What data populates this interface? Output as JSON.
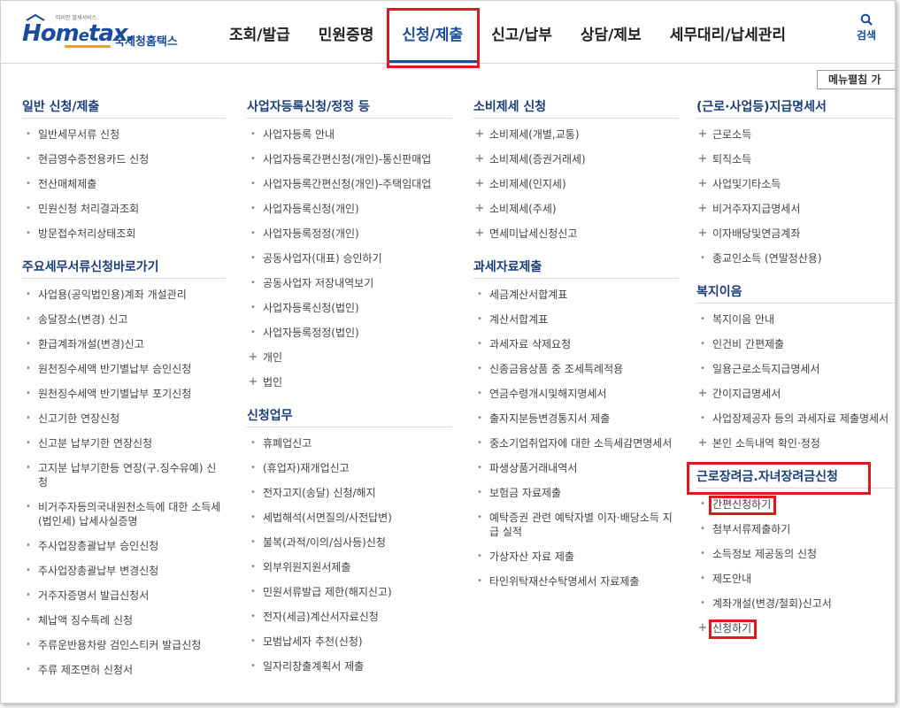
{
  "logo": {
    "tiny": "티이안 발세서비스",
    "main_left": "Hom",
    "main_e": "e",
    "main_right": "tax.",
    "sub": "국세청홈택스"
  },
  "nav": {
    "items": [
      "조회/발급",
      "민원증명",
      "신청/제출",
      "신고/납부",
      "상담/제보",
      "세무대리/납세관리"
    ],
    "active_index": 2
  },
  "search": {
    "label": "검색",
    "icon": "search-icon"
  },
  "menu_toggle": "메뉴펼침 가",
  "columns": [
    {
      "sections": [
        {
          "title": "일반 신청/제출",
          "items": [
            {
              "m": "•",
              "t": "일반세무서류 신청"
            },
            {
              "m": "•",
              "t": "현금영수증전용카드 신청"
            },
            {
              "m": "•",
              "t": "전산매체제출"
            },
            {
              "m": "•",
              "t": "민원신청 처리결과조회"
            },
            {
              "m": "•",
              "t": "방문접수처리상태조회"
            }
          ]
        },
        {
          "title": "주요세무서류신청바로가기",
          "items": [
            {
              "m": "•",
              "t": "사업용(공익법인용)계좌 개설관리"
            },
            {
              "m": "•",
              "t": "송달장소(변경) 신고"
            },
            {
              "m": "•",
              "t": "환급계좌개설(변경)신고"
            },
            {
              "m": "•",
              "t": "원천징수세액 반기별납부 승인신청"
            },
            {
              "m": "•",
              "t": "원천징수세액 반기별납부 포기신청"
            },
            {
              "m": "•",
              "t": "신고기한 연장신청"
            },
            {
              "m": "•",
              "t": "신고분 납부기한 연장신청"
            },
            {
              "m": "•",
              "t": "고지분 납부기한등 연장(구.징수유예) 신청"
            },
            {
              "m": "•",
              "t": "비거주자등의국내원천소득에 대한 소득세(법인세) 납세사실증명"
            },
            {
              "m": "•",
              "t": "주사업장총괄납부 승인신청"
            },
            {
              "m": "•",
              "t": "주사업장총괄납부 변경신청"
            },
            {
              "m": "•",
              "t": "거주자증명서 발급신청서"
            },
            {
              "m": "•",
              "t": "체납액 징수특례 신청"
            },
            {
              "m": "•",
              "t": "주류운반용차량 검인스티커 발급신청"
            },
            {
              "m": "•",
              "t": "주류 제조면허 신청서"
            }
          ]
        }
      ]
    },
    {
      "sections": [
        {
          "title": "사업자등록신청/정정 등",
          "items": [
            {
              "m": "•",
              "t": "사업자등록 안내"
            },
            {
              "m": "•",
              "t": "사업자등록간편신청(개인)-통신판매업"
            },
            {
              "m": "•",
              "t": "사업자등록간편신청(개인)-주택임대업"
            },
            {
              "m": "•",
              "t": "사업자등록신청(개인)"
            },
            {
              "m": "•",
              "t": "사업자등록정정(개인)"
            },
            {
              "m": "•",
              "t": "공동사업자(대표) 승인하기"
            },
            {
              "m": "•",
              "t": "공동사업자 저장내역보기"
            },
            {
              "m": "•",
              "t": "사업자등록신청(법인)"
            },
            {
              "m": "•",
              "t": "사업자등록정정(법인)"
            },
            {
              "m": "+",
              "t": "개인"
            },
            {
              "m": "+",
              "t": "법인"
            }
          ]
        },
        {
          "title": "신청업무",
          "items": [
            {
              "m": "•",
              "t": "휴폐업신고"
            },
            {
              "m": "•",
              "t": "(휴업자)재개업신고"
            },
            {
              "m": "•",
              "t": "전자고지(송달) 신청/해지"
            },
            {
              "m": "•",
              "t": "세법해석(서면질의/사전답변)"
            },
            {
              "m": "•",
              "t": "불복(과적/이의/심사등)신청"
            },
            {
              "m": "•",
              "t": "외부위원지원서제출"
            },
            {
              "m": "•",
              "t": "민원서류발급 제한(해지신고)"
            },
            {
              "m": "•",
              "t": "전자(세금)계산서자료신청"
            },
            {
              "m": "•",
              "t": "모범납세자 추천(신청)"
            },
            {
              "m": "•",
              "t": "일자리창출계획서 제출"
            }
          ]
        }
      ]
    },
    {
      "sections": [
        {
          "title": "소비제세 신청",
          "items": [
            {
              "m": "+",
              "t": "소비제세(개별,교통)"
            },
            {
              "m": "+",
              "t": "소비제세(증권거래세)"
            },
            {
              "m": "+",
              "t": "소비제세(인지세)"
            },
            {
              "m": "+",
              "t": "소비제세(주세)"
            },
            {
              "m": "+",
              "t": "면세미납세신청신고"
            }
          ]
        },
        {
          "title": "과세자료제출",
          "items": [
            {
              "m": "•",
              "t": "세금계산서합계표"
            },
            {
              "m": "•",
              "t": "계산서합계표"
            },
            {
              "m": "•",
              "t": "과세자료 삭제요청"
            },
            {
              "m": "•",
              "t": "신종금융상품 중 조세특례적용"
            },
            {
              "m": "•",
              "t": "연금수령개시및해지명세서"
            },
            {
              "m": "•",
              "t": "출자지분등변경통지서 제출"
            },
            {
              "m": "•",
              "t": "중소기업취업자에 대한 소득세감면명세서"
            },
            {
              "m": "•",
              "t": "파생상품거래내역서"
            },
            {
              "m": "•",
              "t": "보험금 자료제출"
            },
            {
              "m": "•",
              "t": "예탁증권 관련 예탁자별 이자·배당소득 지급 실적"
            },
            {
              "m": "•",
              "t": "가상자산 자료 제출"
            },
            {
              "m": "•",
              "t": "타인위탁재산수탁명세서 자료제출"
            }
          ]
        }
      ]
    },
    {
      "sections": [
        {
          "title": "(근로·사업등)지급명세서",
          "items": [
            {
              "m": "+",
              "t": "근로소득"
            },
            {
              "m": "+",
              "t": "퇴직소득"
            },
            {
              "m": "+",
              "t": "사업및기타소득"
            },
            {
              "m": "+",
              "t": "비거주자지급명세서"
            },
            {
              "m": "+",
              "t": "이자배당및연금계좌"
            },
            {
              "m": "•",
              "t": "종교인소득 (연말정산용)"
            }
          ]
        },
        {
          "title": "복지이음",
          "items": [
            {
              "m": "•",
              "t": "복지이음 안내"
            },
            {
              "m": "•",
              "t": "인건비 간편제출"
            },
            {
              "m": "•",
              "t": "일용근로소득지급명세서"
            },
            {
              "m": "+",
              "t": "간이지급명세서"
            },
            {
              "m": "•",
              "t": "사업장제공자 등의 과세자료 제출명세서"
            },
            {
              "m": "+",
              "t": "본인 소득내역 확인·정정"
            }
          ]
        },
        {
          "title": "근로장려금.자녀장려금신청",
          "items": [
            {
              "m": "•",
              "t": "간편신청하기"
            },
            {
              "m": "•",
              "t": "첨부서류제출하기"
            },
            {
              "m": "•",
              "t": "소득정보 제공동의 신청"
            },
            {
              "m": "•",
              "t": "제도안내"
            },
            {
              "m": "•",
              "t": "계좌개설(변경/철회)신고서"
            },
            {
              "m": "+",
              "t": "신청하기"
            }
          ]
        }
      ]
    }
  ],
  "colors": {
    "brand": "#1a4c9e",
    "highlight": "#e3171d",
    "section_title": "#1c3f7a"
  }
}
